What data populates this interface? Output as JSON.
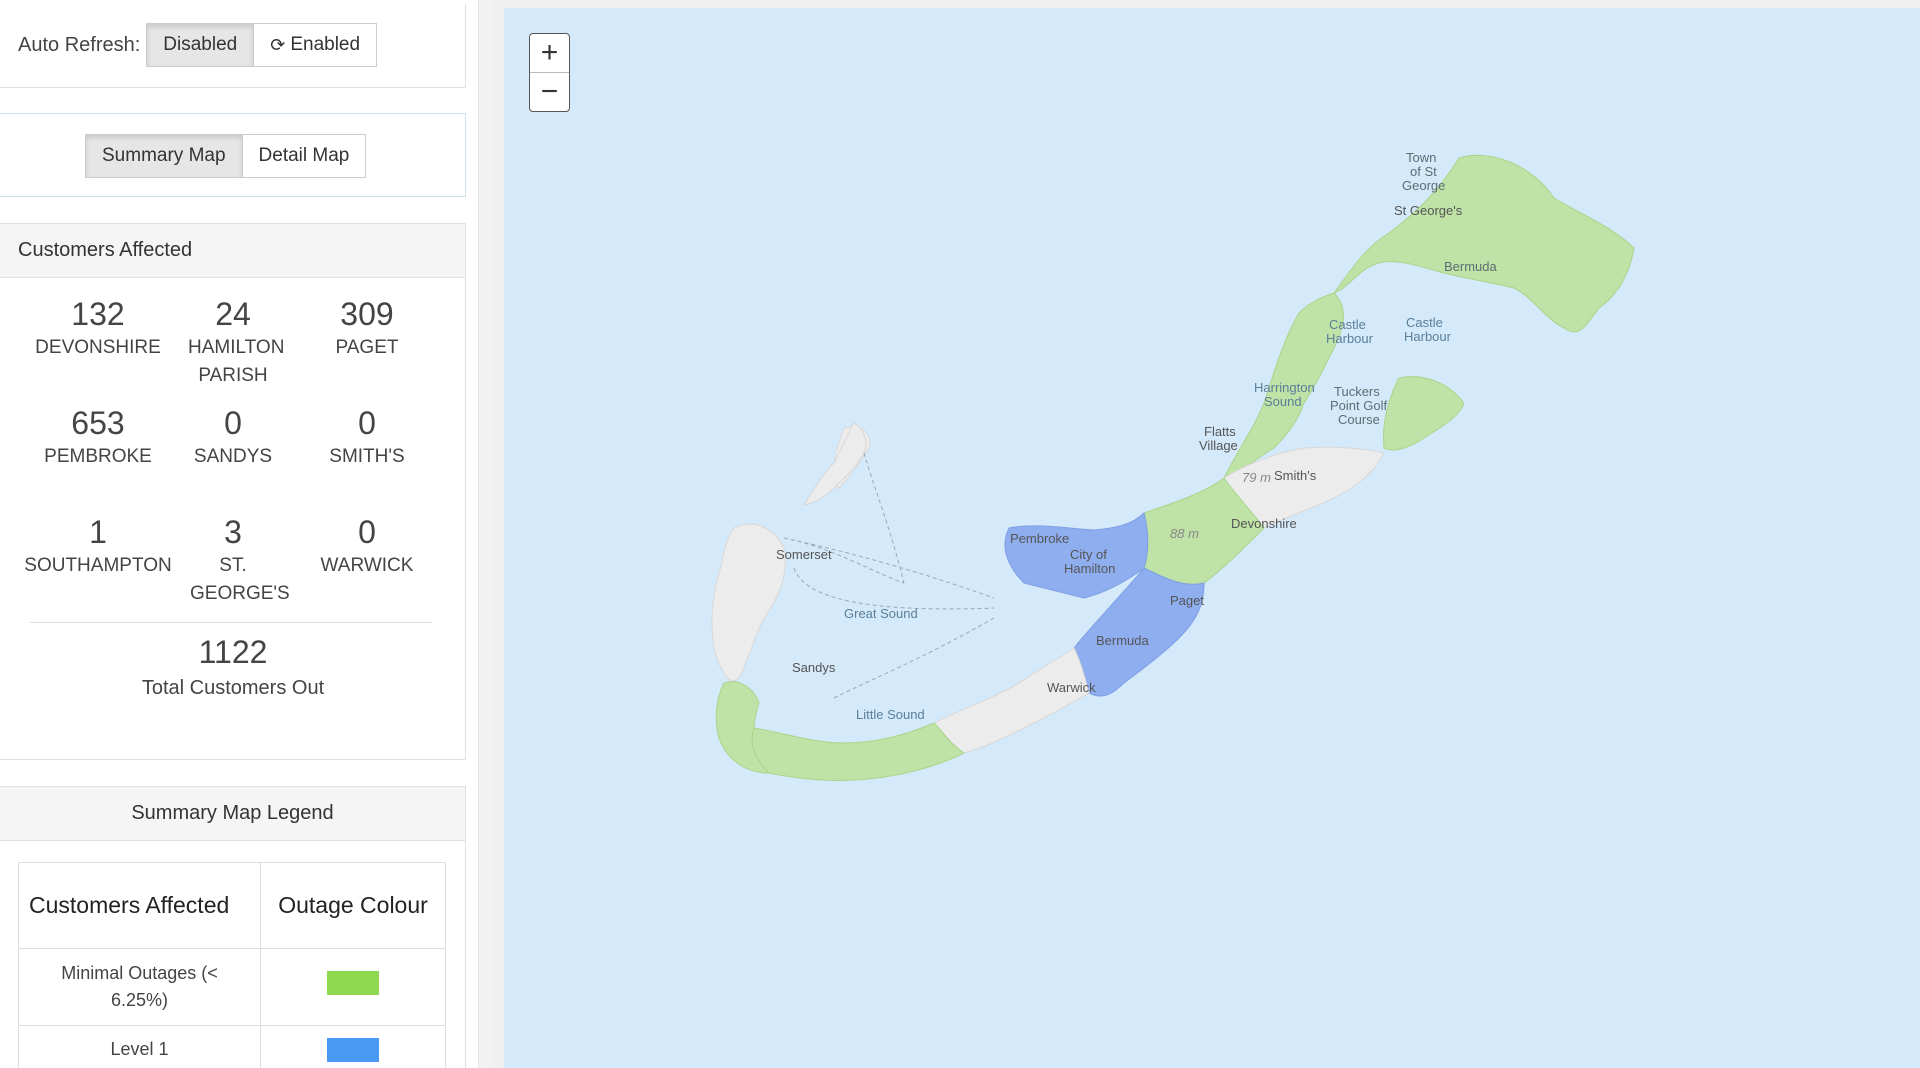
{
  "refresh": {
    "label": "Auto Refresh:",
    "disabled_label": "Disabled",
    "enabled_label": "Enabled",
    "enabled_icon": "sync-icon"
  },
  "map_type": {
    "summary_label": "Summary Map",
    "detail_label": "Detail Map"
  },
  "customers": {
    "title": "Customers Affected",
    "parishes": [
      {
        "count": "132",
        "name": "DEVONSHIRE"
      },
      {
        "count": "24",
        "name": "HAMILTON PARISH"
      },
      {
        "count": "309",
        "name": "PAGET"
      },
      {
        "count": "653",
        "name": "PEMBROKE"
      },
      {
        "count": "0",
        "name": "SANDYS"
      },
      {
        "count": "0",
        "name": "SMITH'S"
      },
      {
        "count": "1",
        "name": "SOUTHAMPTON"
      },
      {
        "count": "3",
        "name": "ST. GEORGE'S"
      },
      {
        "count": "0",
        "name": "WARWICK"
      }
    ],
    "total": {
      "count": "1122",
      "label": "Total Customers Out"
    }
  },
  "legend": {
    "title": "Summary Map Legend",
    "col_affected": "Customers Affected",
    "col_colour": "Outage Colour",
    "rows": [
      {
        "label": "Minimal Outages (< 6.25%)",
        "color": "#8fd94f"
      },
      {
        "label": "Level 1",
        "color": "#4a9af5"
      }
    ]
  },
  "map": {
    "zoom_in": "+",
    "zoom_out": "−",
    "labels": {
      "town_st_george": [
        "Town",
        "of St",
        "George"
      ],
      "st_georges": "St George's",
      "bermuda_ne": "Bermuda",
      "castle_harbour_1": [
        "Castle",
        "Harbour"
      ],
      "castle_harbour_2": [
        "Castle",
        "Harbour"
      ],
      "harrington": [
        "Harrington",
        "Sound"
      ],
      "tuckers": [
        "Tuckers",
        "Point Golf",
        "Course"
      ],
      "flatts": [
        "Flatts",
        "Village"
      ],
      "height_79": "79 m",
      "smiths": "Smith's",
      "height_88": "88 m",
      "devonshire": "Devonshire",
      "pembroke": "Pembroke",
      "hamilton": [
        "City of",
        "Hamilton"
      ],
      "paget": "Paget",
      "somerset": "Somerset",
      "great_sound": "Great Sound",
      "bermuda_sw": "Bermuda",
      "sandys": "Sandys",
      "warwick": "Warwick",
      "little_sound": "Little Sound"
    },
    "colors": {
      "water": "#d4e9f9",
      "land": "#ececec",
      "green": "#bfe2a6",
      "blue": "#8eaef0"
    }
  }
}
